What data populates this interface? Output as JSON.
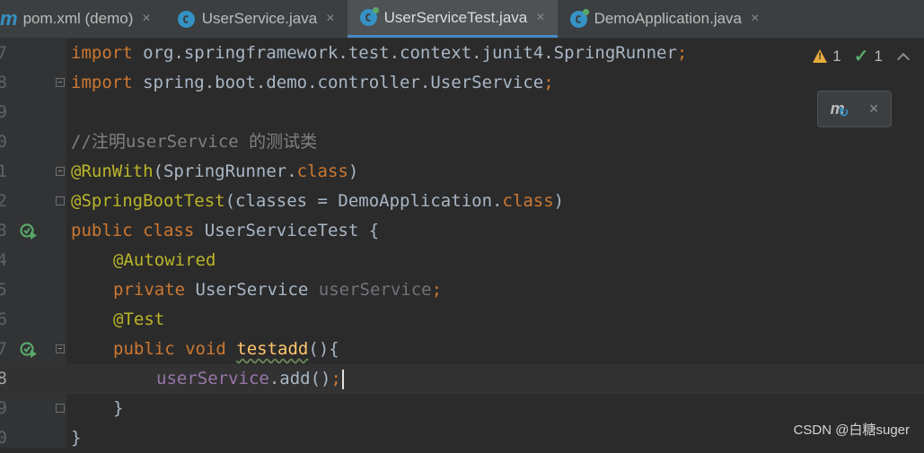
{
  "tabs": [
    {
      "label": "pom.xml (demo)",
      "icon": "maven-icon",
      "active": false
    },
    {
      "label": "UserService.java",
      "icon": "java-class-icon",
      "active": false
    },
    {
      "label": "UserServiceTest.java",
      "icon": "java-test-class-icon",
      "active": true
    },
    {
      "label": "DemoApplication.java",
      "icon": "spring-boot-class-icon",
      "active": false
    }
  ],
  "maven_glyph": "m",
  "close_glyph": "×",
  "inspections": {
    "warnings": "1",
    "ok": "1"
  },
  "maven_popup": {
    "icon": "maven-reload-icon",
    "glyph": "m",
    "close": "×"
  },
  "gutter": {
    "line_numbers": [
      "7",
      "8",
      "9",
      "0",
      "1",
      "2",
      "3",
      "4",
      "5",
      "6",
      "7",
      "8",
      "9",
      "0"
    ]
  },
  "code": {
    "l1_kw": "import",
    "l1_rest": " org.springframework.test.context.junit4.SpringRunner",
    "l1_semi": ";",
    "l2_kw": "import",
    "l2_rest": " spring.boot.demo.controller.UserService",
    "l2_semi": ";",
    "l4_comment": "//注明userService 的测试类",
    "l5_ann": "@RunWith",
    "l5_a": "(SpringRunner.",
    "l5_kw": "class",
    "l5_b": ")",
    "l6_ann": "@SpringBootTest",
    "l6_a": "(classes = DemoApplication.",
    "l6_kw": "class",
    "l6_b": ")",
    "l7_kw": "public class",
    "l7_rest": " UserServiceTest {",
    "l8_ann": "@Autowired",
    "l9_kw": "private",
    "l9_type": " UserService ",
    "l9_field": "userService",
    "l9_semi": ";",
    "l10_ann": "@Test",
    "l11_kw": "public void",
    "l11_fn": "testadd",
    "l11_rest": "(){",
    "l12_field": "userService",
    "l12_call": ".add()",
    "l12_semi": ";",
    "l13_brace": "}",
    "l14_brace": "}"
  },
  "watermark": "CSDN @白糖suger",
  "colors": {
    "background": "#2b2b2b",
    "keyword": "#cc7832",
    "annotation": "#bbb529",
    "comment": "#808080",
    "field": "#9876aa",
    "function": "#ffc66d",
    "accent": "#4a88c7"
  }
}
